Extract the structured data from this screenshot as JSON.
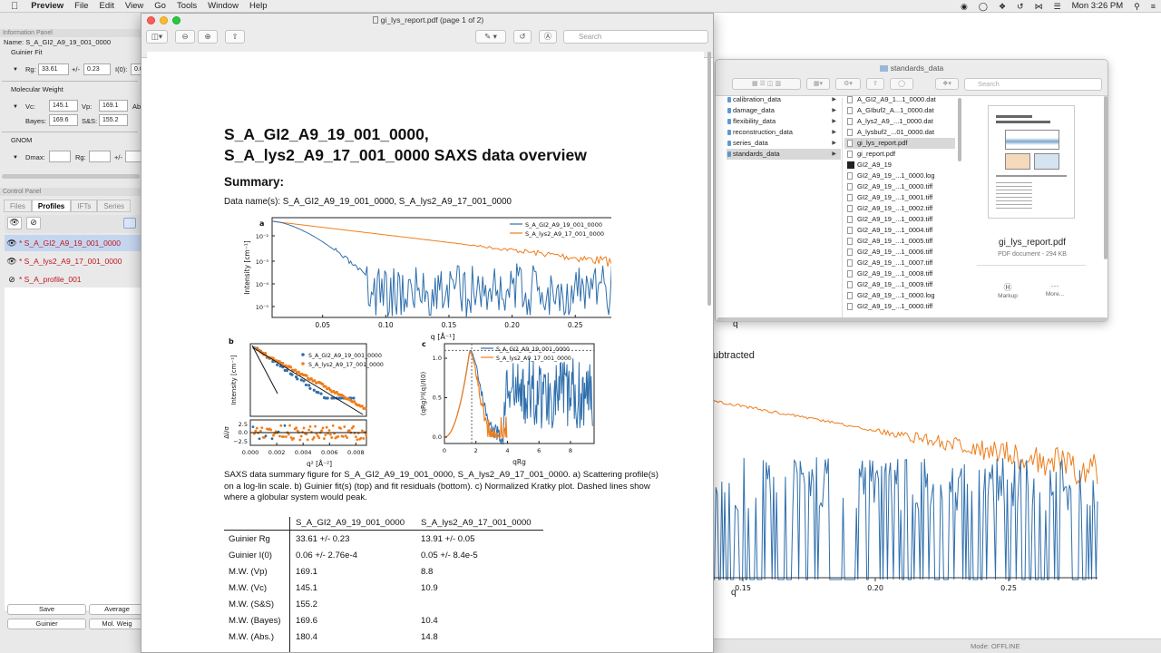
{
  "menubar": {
    "app": "Preview",
    "items": [
      "File",
      "Edit",
      "View",
      "Go",
      "Tools",
      "Window",
      "Help"
    ],
    "clock": "Mon 3:26 PM"
  },
  "left": {
    "info_panel": "Information Panel",
    "name_label": "Name:",
    "name_value": "S_A_GI2_A9_19_001_0000",
    "guinier": "Guinier Fit",
    "rg_label": "Rg:",
    "rg_value": "33.61",
    "pm": "+/-",
    "rg_err": "0.23",
    "i0_label": "I(0):",
    "i0_value": "0.0",
    "mw": "Molecular Weight",
    "vc_label": "Vc:",
    "vc_value": "145.1",
    "vp_label": "Vp:",
    "vp_value": "169.1",
    "abs_label": "Ab",
    "bayes_label": "Bayes:",
    "bayes_value": "169.6",
    "ss_label": "S&S:",
    "ss_value": "155.2",
    "gnom": "GNOM",
    "dmax_label": "Dmax:",
    "grg_label": "Rg:",
    "gpm": "+/-",
    "control_panel": "Control Panel",
    "tabs": [
      "Files",
      "Profiles",
      "IFTs",
      "Series"
    ],
    "profiles": [
      "* S_A_GI2_A9_19_001_0000",
      "* S_A_lys2_A9_17_001_0000",
      "* S_A_profile_001"
    ],
    "buttons": {
      "save": "Save",
      "average": "Average",
      "guinier": "Guinier",
      "mol_weight": "Mol. Weig"
    }
  },
  "plotbg": {
    "label_q_top": "q",
    "subtracted": "ubtracted",
    "xlabel": "q",
    "ticks": [
      "0.15",
      "0.20",
      "0.25"
    ],
    "status": "Mode: OFFLINE"
  },
  "finder": {
    "title": "standards_data",
    "search": "Search",
    "folders": [
      "calibration_data",
      "damage_data",
      "flexibility_data",
      "reconstruction_data",
      "series_data",
      "standards_data"
    ],
    "files": [
      "A_GI2_A9_1...1_0000.dat",
      "A_GIbuf2_A...1_0000.dat",
      "A_lys2_A9_...1_0000.dat",
      "A_lysbuf2_...01_0000.dat",
      "gi_lys_report.pdf",
      "gi_report.pdf",
      "GI2_A9_19",
      "GI2_A9_19_...1_0000.log",
      "GI2_A9_19_...1_0000.tiff",
      "GI2_A9_19_...1_0001.tiff",
      "GI2_A9_19_...1_0002.tiff",
      "GI2_A9_19_...1_0003.tiff",
      "GI2_A9_19_...1_0004.tiff",
      "GI2_A9_19_...1_0005.tiff",
      "GI2_A9_19_...1_0006.tiff",
      "GI2_A9_19_...1_0007.tiff",
      "GI2_A9_19_...1_0008.tiff",
      "GI2_A9_19_...1_0009.tiff",
      "GI2_A9_19_...1_0000.log",
      "GI2_A9_19_...1_0000.tiff"
    ],
    "preview_name": "gi_lys_report.pdf",
    "preview_kind": "PDF document - 294 KB",
    "markup": "Markup",
    "more": "More..."
  },
  "preview": {
    "title": "gi_lys_report.pdf (page 1 of 2)",
    "search": "Search",
    "h1_line1": "S_A_GI2_A9_19_001_0000,",
    "h1_line2": "S_A_lys2_A9_17_001_0000 SAXS data overview",
    "summary": "Summary:",
    "data_names": "Data name(s): S_A_GI2_A9_19_001_0000, S_A_lys2_A9_17_001_0000",
    "caption": "SAXS data summary figure for S_A_GI2_A9_19_001_0000, S_A_lys2_A9_17_001_0000. a) Scattering profile(s) on a log-lin scale. b) Guinier fit(s) (top) and fit residuals (bottom). c) Normalized Kratky plot. Dashed lines show where a globular system would peak.",
    "table": {
      "headers": [
        "",
        "S_A_GI2_A9_19_001_0000",
        "S_A_lys2_A9_17_001_0000"
      ],
      "rows": [
        [
          "Guinier Rg",
          "33.61 +/- 0.23",
          "13.91 +/- 0.05"
        ],
        [
          "Guinier I(0)",
          "0.06 +/- 2.76e-4",
          "0.05 +/- 8.4e-5"
        ],
        [
          "M.W. (Vp)",
          "169.1",
          "8.8"
        ],
        [
          "M.W. (Vc)",
          "145.1",
          "10.9"
        ],
        [
          "M.W. (S&S)",
          "155.2",
          ""
        ],
        [
          "M.W. (Bayes)",
          "169.6",
          "10.4"
        ],
        [
          "M.W. (Abs.)",
          "180.4",
          "14.8"
        ]
      ]
    }
  },
  "chart_data": [
    {
      "type": "line",
      "panel": "a",
      "xlabel": "q [Å⁻¹]",
      "ylabel": "Intensity [cm⁻¹]",
      "yscale": "log",
      "x_ticks": [
        "0.05",
        "0.10",
        "0.15",
        "0.20",
        "0.25"
      ],
      "y_ticks": [
        "10⁻²",
        "10⁻³",
        "10⁻⁴",
        "10⁻⁵"
      ],
      "xlim": [
        0.01,
        0.28
      ],
      "series": [
        {
          "name": "S_A_GI2_A9_19_001_0000",
          "color": "#2f6fad"
        },
        {
          "name": "S_A_lys2_A9_17_001_0000",
          "color": "#ef7d1a"
        }
      ]
    },
    {
      "type": "scatter",
      "panel": "b",
      "xlabel": "q² [Å⁻²]",
      "ylabel": "Intensity [cm⁻¹]",
      "ylabel2": "Δl/σ",
      "x_ticks": [
        "0.000",
        "0.002",
        "0.004",
        "0.006",
        "0.008"
      ],
      "y2_ticks": [
        "2.5",
        "0.0",
        "−2.5"
      ],
      "series": [
        {
          "name": "S_A_GI2_A9_19_001_0000",
          "color": "#2f6fad"
        },
        {
          "name": "S_A_lys2_A9_17_001_0000",
          "color": "#ef7d1a"
        }
      ]
    },
    {
      "type": "line",
      "panel": "c",
      "xlabel": "qRg",
      "ylabel": "(qRg)²I(q)/I(0)",
      "x_ticks": [
        "0",
        "2",
        "4",
        "6",
        "8"
      ],
      "y_ticks": [
        "1.0",
        "0.5",
        "0.0"
      ],
      "series": [
        {
          "name": "S_A_GI2_A9_19_001_0000",
          "color": "#2f6fad"
        },
        {
          "name": "S_A_lys2_A9_17_001_0000",
          "color": "#ef7d1a"
        }
      ]
    }
  ]
}
